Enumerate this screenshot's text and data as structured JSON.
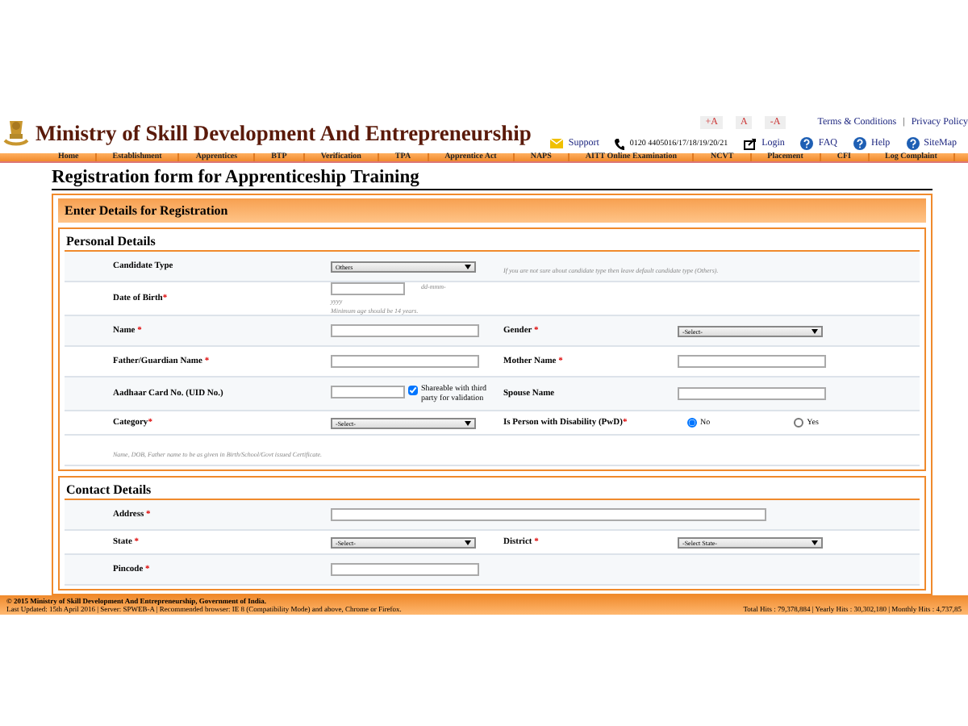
{
  "header": {
    "title": "Ministry of Skill Development And Entrepreneurship",
    "font_buttons": [
      "+A",
      "A",
      "-A"
    ],
    "top_links": [
      "Terms & Conditions",
      "Privacy Policy"
    ],
    "link_separator": "|",
    "contact_links": [
      {
        "kind": "mail",
        "label": "Support"
      },
      {
        "kind": "phone",
        "label": "0120 4405016/17/18/19/20/21"
      },
      {
        "kind": "login",
        "label": "Login"
      },
      {
        "kind": "help",
        "label": "FAQ"
      },
      {
        "kind": "help",
        "label": "Help"
      },
      {
        "kind": "help",
        "label": "SiteMap"
      }
    ]
  },
  "nav": [
    "Home",
    "Establishment",
    "Apprentices",
    "BTP",
    "Verification",
    "TPA",
    "Apprentice Act",
    "NAPS",
    "AITT Online Examination",
    "NCVT",
    "Placement",
    "CFI",
    "Log Complaint"
  ],
  "page_title": "Registration form for Apprenticeship Training",
  "form_header": "Enter Details for Registration",
  "sections": [
    {
      "title": "Personal Details",
      "rows": [
        {
          "kind": "pair",
          "cells": [
            {
              "label": "Candidate Type",
              "control": {
                "kind": "select",
                "value": "Others"
              }
            },
            {
              "kind": "hint",
              "text": "If you are not sure about candidate type then leave default candidate type (Others)."
            }
          ]
        },
        {
          "kind": "pair",
          "cells": [
            {
              "label": "Date of Birth",
              "mark": "*",
              "control": {
                "kind": "date",
                "format_1": "dd-mmm-",
                "format_2": "yyyy",
                "hint": "Minimum age should be 14 years."
              }
            }
          ]
        },
        {
          "kind": "pair",
          "cells": [
            {
              "label": "Name ",
              "mark": "*",
              "control": {
                "kind": "input"
              }
            },
            {
              "label": "Gender ",
              "mark": "*",
              "control": {
                "kind": "select",
                "value": "-Select-"
              }
            }
          ]
        },
        {
          "kind": "pair",
          "cells": [
            {
              "label": "Father/Guardian Name ",
              "mark": "*",
              "control": {
                "kind": "input"
              }
            },
            {
              "label": "Mother Name ",
              "mark": "*",
              "control": {
                "kind": "input"
              }
            }
          ]
        },
        {
          "kind": "pair",
          "cells": [
            {
              "label": "Aadhaar Card No. (UID No.)",
              "control": {
                "kind": "input_check",
                "checked": true,
                "check_label": "Shareable with third party for validation"
              }
            },
            {
              "label": "Spouse Name",
              "control": {
                "kind": "input"
              }
            }
          ]
        },
        {
          "kind": "pair",
          "cells": [
            {
              "label": "Category",
              "mark": "*",
              "control": {
                "kind": "select",
                "value": "-Select-"
              }
            },
            {
              "label": "Is Person with Disability (PwD)",
              "mark": "*",
              "control": {
                "kind": "radio",
                "options": [
                  {
                    "label": "No",
                    "selected": true
                  },
                  {
                    "label": "Yes",
                    "selected": false
                  }
                ]
              }
            }
          ]
        },
        {
          "kind": "note",
          "text": "Name, DOB, Father name to be as given in Birth/School/Govt issued Certificate."
        }
      ]
    },
    {
      "title": "Contact Details",
      "rows": [
        {
          "kind": "pair",
          "cells": [
            {
              "label": "Address ",
              "mark": "*",
              "control": {
                "kind": "wide_input"
              }
            }
          ]
        },
        {
          "kind": "pair",
          "cells": [
            {
              "label": "State ",
              "mark": "*",
              "control": {
                "kind": "select",
                "value": "-Select-"
              }
            },
            {
              "label": "District ",
              "mark": "*",
              "control": {
                "kind": "select",
                "value": "-Select State-"
              }
            }
          ]
        },
        {
          "kind": "pair",
          "cells": [
            {
              "label": "Pincode ",
              "mark": "*",
              "control": {
                "kind": "input"
              }
            }
          ]
        }
      ]
    }
  ],
  "footer": {
    "copyright": "© 2015 Ministry of Skill Development And Entrepreneurship, Government of India.",
    "updated": "Last Updated: 15th April 2016 | Server: SPWEB-A | Recommended browser: IE 8 (Compatibility Mode) and above, Chrome or Firefox.",
    "hits": "Total Hits : 79,378,884 | Yearly Hits : 30,302,180 | Monthly Hits : 4,737,85"
  }
}
